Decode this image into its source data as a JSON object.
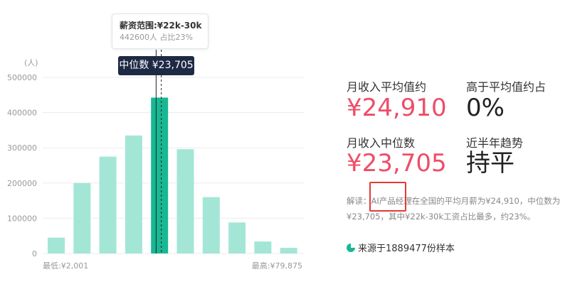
{
  "colors": {
    "bar": "#a3e6d6",
    "bar_active": "#17b893",
    "grid": "#ececec",
    "accent_red": "#ee4d68",
    "dark_label": "#1e2a44",
    "icon": "#17b893"
  },
  "chart_data": {
    "type": "bar",
    "yunit": "(人)",
    "ylim": [
      0,
      500000
    ],
    "yticks": [
      "0",
      "100000",
      "200000",
      "300000",
      "400000",
      "500000"
    ],
    "values": [
      45000,
      200000,
      275000,
      335000,
      442600,
      296000,
      160000,
      88000,
      34000,
      16000
    ],
    "highlight_index": 4,
    "median_position": 4.3,
    "xmin_label": "最低:¥2,001",
    "xmax_label": "最高:¥79,875",
    "grid": true
  },
  "tooltip": {
    "title": "薪资范围:¥22k-30k",
    "detail": "442600人  占比23%"
  },
  "median_label": "中位数 ¥23,705",
  "stats": {
    "avg_label": "月收入平均值约",
    "avg_value": "¥24,910",
    "above_label": "高于平均值约占",
    "above_value": "0%",
    "median_label": "月收入中位数",
    "median_value": "¥23,705",
    "trend_label": "近半年趋势",
    "trend_value": "持平"
  },
  "description": {
    "line1": "解读：AI产品经理在全国的平均月薪为¥24,910，中位数为",
    "line2": "¥23,705，其中¥22k-30k工资占比最多，约23%。"
  },
  "source": {
    "icon": "pie-chart-icon",
    "text": "来源于1889477份样本"
  }
}
